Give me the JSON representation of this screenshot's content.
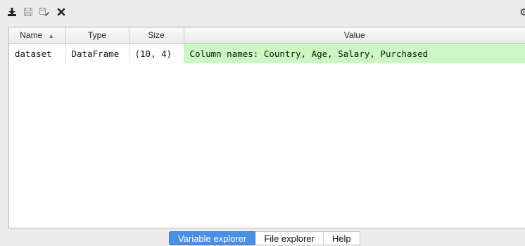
{
  "toolbar": {
    "buttons": [
      {
        "icon": "import-data-icon"
      },
      {
        "icon": "save-data-icon"
      },
      {
        "icon": "save-as-icon"
      },
      {
        "icon": "remove-all-icon"
      }
    ],
    "options_icon": "gear-icon"
  },
  "table": {
    "headers": {
      "name": "Name",
      "type": "Type",
      "size": "Size",
      "value": "Value",
      "sort_indicator": "▲"
    },
    "rows": [
      {
        "name": "dataset",
        "type": "DataFrame",
        "size": "(10, 4)",
        "value": "Column names: Country, Age, Salary, Purchased"
      }
    ]
  },
  "tabs": [
    {
      "label": "Variable explorer",
      "active": true
    },
    {
      "label": "File explorer",
      "active": false
    },
    {
      "label": "Help",
      "active": false
    }
  ],
  "colors": {
    "value_highlight": "#cbf7c3",
    "active_tab": "#4a8fe6",
    "background": "#ececec"
  }
}
